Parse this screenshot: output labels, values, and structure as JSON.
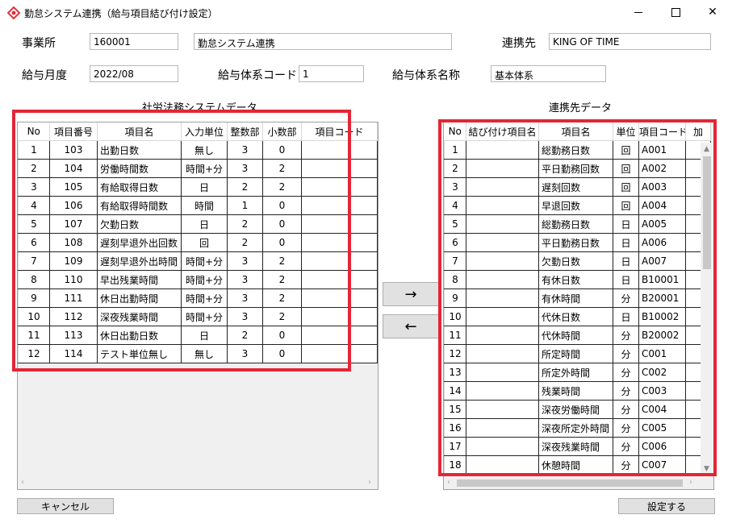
{
  "window": {
    "title": "勤怠システム連携（給与項目結び付け設定）",
    "controls": {
      "minimize": "minimize-icon",
      "maximize": "maximize-icon",
      "close": "close-icon"
    }
  },
  "header": {
    "office_label": "事業所",
    "office_code": "160001",
    "office_name": "勤怠システム連携",
    "partner_label": "連携先",
    "partner_name": "KING OF TIME",
    "pay_month_label": "給与月度",
    "pay_month": "2022/08",
    "pay_system_code_label": "給与体系コード",
    "pay_system_code": "1",
    "pay_system_name_label": "給与体系名称",
    "pay_system_name": "基本体系"
  },
  "left_grid": {
    "title": "社労法務システムデータ",
    "columns": [
      "No",
      "項目番号",
      "項目名",
      "入力単位",
      "整数部",
      "小数部",
      "項目コード"
    ],
    "rows": [
      {
        "no": "1",
        "num": "103",
        "name": "出勤日数",
        "unit": "無し",
        "int": "3",
        "dec": "0",
        "code": ""
      },
      {
        "no": "2",
        "num": "104",
        "name": "労働時間数",
        "unit": "時間+分",
        "int": "3",
        "dec": "2",
        "code": ""
      },
      {
        "no": "3",
        "num": "105",
        "name": "有給取得日数",
        "unit": "日",
        "int": "2",
        "dec": "2",
        "code": ""
      },
      {
        "no": "4",
        "num": "106",
        "name": "有給取得時間数",
        "unit": "時間",
        "int": "1",
        "dec": "0",
        "code": ""
      },
      {
        "no": "5",
        "num": "107",
        "name": "欠勤日数",
        "unit": "日",
        "int": "2",
        "dec": "0",
        "code": ""
      },
      {
        "no": "6",
        "num": "108",
        "name": "遅刻早退外出回数",
        "unit": "回",
        "int": "2",
        "dec": "0",
        "code": ""
      },
      {
        "no": "7",
        "num": "109",
        "name": "遅刻早退外出時間",
        "unit": "時間+分",
        "int": "3",
        "dec": "2",
        "code": ""
      },
      {
        "no": "8",
        "num": "110",
        "name": "早出残業時間",
        "unit": "時間+分",
        "int": "3",
        "dec": "2",
        "code": ""
      },
      {
        "no": "9",
        "num": "111",
        "name": "休日出勤時間",
        "unit": "時間+分",
        "int": "3",
        "dec": "2",
        "code": ""
      },
      {
        "no": "10",
        "num": "112",
        "name": "深夜残業時間",
        "unit": "時間+分",
        "int": "3",
        "dec": "2",
        "code": ""
      },
      {
        "no": "11",
        "num": "113",
        "name": "休日出勤日数",
        "unit": "日",
        "int": "2",
        "dec": "0",
        "code": ""
      },
      {
        "no": "12",
        "num": "114",
        "name": "テスト単位無し",
        "unit": "無し",
        "int": "3",
        "dec": "0",
        "code": ""
      }
    ]
  },
  "right_grid": {
    "title": "連携先データ",
    "columns": [
      "No",
      "結び付け項目名",
      "項目名",
      "単位",
      "項目コード",
      "加"
    ],
    "rows": [
      {
        "no": "1",
        "linked": "",
        "name": "総勤務日数",
        "unit": "回",
        "code": "A001"
      },
      {
        "no": "2",
        "linked": "",
        "name": "平日勤務回数",
        "unit": "回",
        "code": "A002"
      },
      {
        "no": "3",
        "linked": "",
        "name": "遅刻回数",
        "unit": "回",
        "code": "A003"
      },
      {
        "no": "4",
        "linked": "",
        "name": "早退回数",
        "unit": "回",
        "code": "A004"
      },
      {
        "no": "5",
        "linked": "",
        "name": "総勤務日数",
        "unit": "日",
        "code": "A005"
      },
      {
        "no": "6",
        "linked": "",
        "name": "平日勤務日数",
        "unit": "日",
        "code": "A006"
      },
      {
        "no": "7",
        "linked": "",
        "name": "欠勤日数",
        "unit": "日",
        "code": "A007"
      },
      {
        "no": "8",
        "linked": "",
        "name": "有休日数",
        "unit": "日",
        "code": "B10001"
      },
      {
        "no": "9",
        "linked": "",
        "name": "有休時間",
        "unit": "分",
        "code": "B20001"
      },
      {
        "no": "10",
        "linked": "",
        "name": "代休日数",
        "unit": "日",
        "code": "B10002"
      },
      {
        "no": "11",
        "linked": "",
        "name": "代休時間",
        "unit": "分",
        "code": "B20002"
      },
      {
        "no": "12",
        "linked": "",
        "name": "所定時間",
        "unit": "分",
        "code": "C001"
      },
      {
        "no": "13",
        "linked": "",
        "name": "所定外時間",
        "unit": "分",
        "code": "C002"
      },
      {
        "no": "14",
        "linked": "",
        "name": "残業時間",
        "unit": "分",
        "code": "C003"
      },
      {
        "no": "15",
        "linked": "",
        "name": "深夜労働時間",
        "unit": "分",
        "code": "C004"
      },
      {
        "no": "16",
        "linked": "",
        "name": "深夜所定外時間",
        "unit": "分",
        "code": "C005"
      },
      {
        "no": "17",
        "linked": "",
        "name": "深夜残業時間",
        "unit": "分",
        "code": "C006"
      },
      {
        "no": "18",
        "linked": "",
        "name": "休憩時間",
        "unit": "分",
        "code": "C007"
      }
    ]
  },
  "buttons": {
    "move_right": "→",
    "move_left": "←",
    "cancel": "キャンセル",
    "apply": "設定する"
  },
  "highlight_color": "#e32636"
}
